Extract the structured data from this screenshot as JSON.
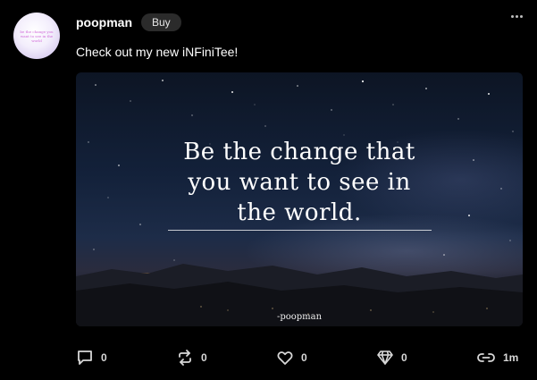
{
  "author": {
    "username": "poopman",
    "buy_label": "Buy",
    "avatar_text": "be the change you want to see in the world"
  },
  "post": {
    "text": "Check out my new iNFiniTee!",
    "image": {
      "quote_lines": [
        "Be the change that",
        "you want to see in",
        "the world."
      ],
      "signature": "-poopman"
    }
  },
  "actions": {
    "comments": "0",
    "reposts": "0",
    "likes": "0",
    "tips": "0",
    "age": "1m"
  },
  "icons": {
    "more": "more-horizontal-icon",
    "comment": "comment-icon",
    "repost": "repost-icon",
    "like": "heart-icon",
    "tip": "diamond-icon",
    "link": "link-icon"
  },
  "colors": {
    "background": "#000000",
    "text": "#ffffff",
    "muted": "#d8d8d8",
    "badge": "#2b2b2b"
  }
}
